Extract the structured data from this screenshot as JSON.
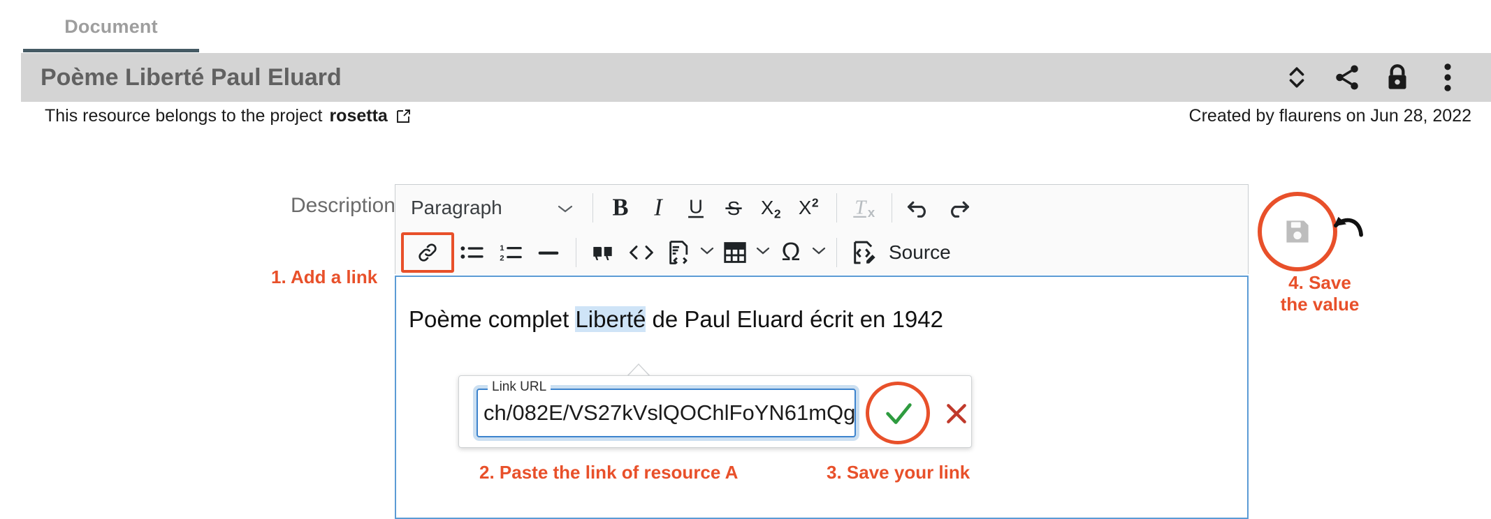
{
  "tab": {
    "label": "Document"
  },
  "header": {
    "title": "Poème Liberté Paul Eluard",
    "actions": [
      {
        "name": "expand-collapse-icon",
        "label": "Expand / collapse"
      },
      {
        "name": "share-icon",
        "label": "Share"
      },
      {
        "name": "lock-icon",
        "label": "Lock"
      },
      {
        "name": "more-options-icon",
        "label": "More options"
      }
    ]
  },
  "subline": {
    "belongs_prefix": "This resource belongs to the project",
    "project_name": "rosetta",
    "external_link_icon": "external-link-icon",
    "created_by": "Created by flaurens on Jun 28, 2022"
  },
  "form": {
    "description_label": "Description"
  },
  "toolbar": {
    "paragraph_style": "Paragraph",
    "row1": [
      {
        "name": "bold-button",
        "glyph": "B"
      },
      {
        "name": "italic-button",
        "glyph": "I"
      },
      {
        "name": "underline-button",
        "glyph": "U"
      },
      {
        "name": "strikethrough-button",
        "glyph": "S"
      },
      {
        "name": "subscript-button",
        "glyph": "X₂"
      },
      {
        "name": "superscript-button",
        "glyph": "X²"
      },
      {
        "name": "remove-format-button",
        "glyph": "Tx"
      },
      {
        "name": "undo-button",
        "glyph": "↶"
      },
      {
        "name": "redo-button",
        "glyph": "↷"
      }
    ],
    "row2": [
      {
        "name": "link-button",
        "glyph": "link"
      },
      {
        "name": "bulleted-list-button",
        "glyph": "bulleted-list"
      },
      {
        "name": "numbered-list-button",
        "glyph": "numbered-list"
      },
      {
        "name": "horizontal-rule-button",
        "glyph": "horizontal-rule"
      },
      {
        "name": "blockquote-button",
        "glyph": "quote"
      },
      {
        "name": "inline-code-button",
        "glyph": "code"
      },
      {
        "name": "code-block-button",
        "glyph": "code-block"
      },
      {
        "name": "insert-table-button",
        "glyph": "table"
      },
      {
        "name": "special-character-button",
        "glyph": "omega"
      }
    ],
    "source_label": "Source",
    "save_icon_name": "save-floppy-icon",
    "revert_icon_name": "revert-arrow-icon"
  },
  "editor": {
    "text_before": "Poème complet ",
    "selected_word": "Liberté",
    "text_after": " de Paul Eluard écrit en 1942"
  },
  "link_balloon": {
    "field_label": "Link URL",
    "url_value": "ch/082E/VS27kVslQOChlFoYN61mQg",
    "accept_icon": "check-icon",
    "cancel_icon": "close-x-icon"
  },
  "annotations": {
    "step1": "1. Add a link",
    "step2": "2. Paste the link of resource A",
    "step3": "3. Save your link",
    "step4": "4. Save\nthe value"
  },
  "colors": {
    "accent_orange": "#e8502a",
    "tab_underline": "#455a64",
    "header_bar": "#d4d4d4",
    "editor_border": "#5b9bd5",
    "selection": "#cfe4f7",
    "check_green": "#2e9b3f",
    "cancel_red": "#c0392b"
  }
}
